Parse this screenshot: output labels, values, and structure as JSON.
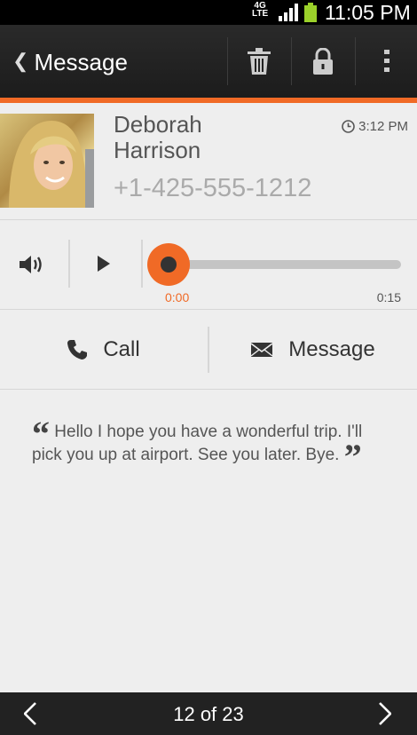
{
  "status_bar": {
    "network": "4G LTE",
    "network_top": "4G",
    "network_bottom": "LTE",
    "time": "11:05 PM"
  },
  "action_bar": {
    "back_label": "Message",
    "actions": [
      "delete-icon",
      "lock-icon",
      "overflow-menu-icon"
    ]
  },
  "contact": {
    "first_name": "Deborah",
    "last_name": "Harrison",
    "phone": "+1-425-555-1212",
    "time": "3:12 PM"
  },
  "player": {
    "current_time": "0:00",
    "duration": "0:15",
    "progress": 0.0
  },
  "actions": {
    "call_label": "Call",
    "message_label": "Message"
  },
  "transcript": {
    "text": "Hello I hope you have a wonderful trip. I'll pick you up at airport. See you later. Bye."
  },
  "pager": {
    "text": "12 of 23"
  },
  "colors": {
    "accent": "#f06a26",
    "bar": "#222222"
  }
}
